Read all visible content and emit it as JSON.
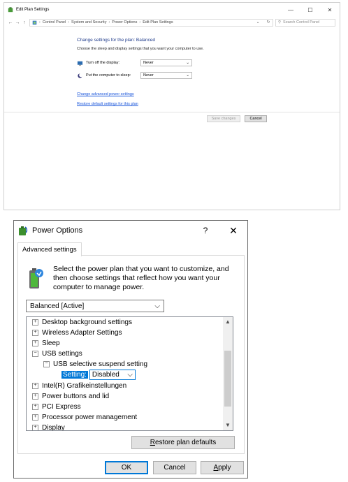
{
  "edit_plan": {
    "title": "Edit Plan Settings",
    "window_controls": {
      "minimize": "—",
      "maximize": "☐",
      "close": "✕"
    },
    "nav": {
      "back": "←",
      "forward": "→",
      "up": "↑"
    },
    "breadcrumbs": [
      "Control Panel",
      "System and Security",
      "Power Options",
      "Edit Plan Settings"
    ],
    "breadcrumb_sep": "›",
    "search_placeholder": "Search Control Panel",
    "heading": "Change settings for the plan: Balanced",
    "subheading": "Choose the sleep and display settings that you want your computer to use.",
    "display_label": "Turn off the display:",
    "display_value": "Never",
    "sleep_label": "Put the computer to sleep:",
    "sleep_value": "Never",
    "advanced_link": "Change advanced power settings",
    "restore_link": "Restore default settings for this plan",
    "save_button": "Save changes",
    "cancel_button": "Cancel"
  },
  "power_options": {
    "title": "Power Options",
    "help": "?",
    "close": "✕",
    "tab": "Advanced settings",
    "intro": "Select the power plan that you want to customize, and then choose settings that reflect how you want your computer to manage power.",
    "plan": "Balanced [Active]",
    "tree": {
      "desktop_background": "Desktop background settings",
      "wireless_adapter": "Wireless Adapter Settings",
      "sleep": "Sleep",
      "usb": "USB settings",
      "usb_suspend": "USB selective suspend setting",
      "setting_label": "Setting:",
      "setting_value": "Disabled",
      "intel_graphics": "Intel(R) Grafikeinstellungen",
      "power_buttons": "Power buttons and lid",
      "pci_express": "PCI Express",
      "processor": "Processor power management",
      "display": "Display"
    },
    "expand": "+",
    "collapse": "−",
    "restore_button": {
      "mnemonic": "R",
      "rest": "estore plan defaults"
    },
    "ok_button": "OK",
    "cancel_button": "Cancel",
    "apply_button": {
      "mnemonic": "A",
      "rest": "pply"
    }
  }
}
